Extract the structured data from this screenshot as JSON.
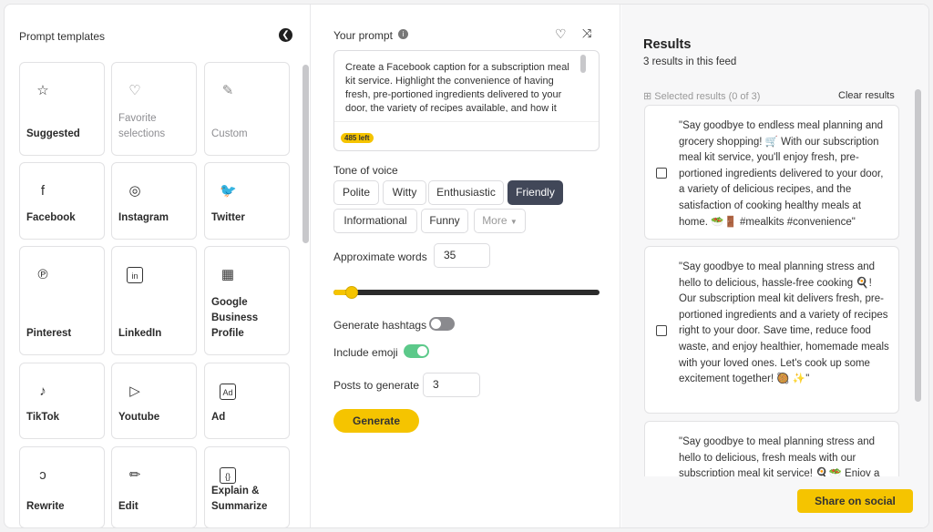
{
  "templates": {
    "title": "Prompt templates",
    "items": [
      {
        "label": "Suggested",
        "icon": "star-icon",
        "glyph": "☆"
      },
      {
        "label": "Favorite selections",
        "icon": "heart-icon",
        "glyph": "♡"
      },
      {
        "label": "Custom",
        "icon": "tools-icon",
        "glyph": "✎"
      },
      {
        "label": "Facebook",
        "icon": "facebook-icon",
        "glyph": "f"
      },
      {
        "label": "Instagram",
        "icon": "instagram-icon",
        "glyph": "◎"
      },
      {
        "label": "Twitter",
        "icon": "twitter-icon",
        "glyph": "🐦"
      },
      {
        "label": "Pinterest",
        "icon": "pinterest-icon",
        "glyph": "℗"
      },
      {
        "label": "LinkedIn",
        "icon": "linkedin-icon",
        "glyph": "in"
      },
      {
        "label": "Google Business Profile",
        "icon": "storefront-icon",
        "glyph": "▦"
      },
      {
        "label": "TikTok",
        "icon": "tiktok-icon",
        "glyph": "♪"
      },
      {
        "label": "Youtube",
        "icon": "youtube-icon",
        "glyph": "▷"
      },
      {
        "label": "Ad",
        "icon": "ad-icon",
        "glyph": "Ad"
      },
      {
        "label": "Rewrite",
        "icon": "rewrite-icon",
        "glyph": "ↄ"
      },
      {
        "label": "Edit",
        "icon": "pencil-icon",
        "glyph": "✏"
      },
      {
        "label": "Explain & Summarize",
        "icon": "brackets-icon",
        "glyph": "{}"
      }
    ]
  },
  "prompt": {
    "title": "Your prompt",
    "text": "Create a Facebook caption for a subscription meal kit service. Highlight the convenience of having fresh, pre-portioned ingredients delivered to your door, the variety of recipes available, and how it",
    "remaining": "485 left",
    "tone_label": "Tone of voice",
    "tones": [
      "Polite",
      "Witty",
      "Enthusiastic",
      "Friendly",
      "Informational",
      "Funny",
      "More"
    ],
    "selected_tone": "Friendly",
    "words_label": "Approximate words",
    "words_value": "35",
    "slider_fraction": 0.05,
    "hashtags_label": "Generate hashtags",
    "hashtags_on": false,
    "emoji_label": "Include emoji",
    "emoji_on": true,
    "posts_label": "Posts to generate",
    "posts_value": "3",
    "generate": "Generate"
  },
  "results": {
    "title": "Results",
    "subtitle": "3 results in this feed",
    "selected": "Selected results (0 of 3)",
    "clear": "Clear results",
    "items": [
      "\"Say goodbye to endless meal planning and grocery shopping! 🛒 With our subscription meal kit service, you'll enjoy fresh, pre-portioned ingredients delivered to your door, a variety of delicious recipes, and the satisfaction of cooking healthy meals at home. 🥗🚪 #mealkits #convenience\"",
      "\"Say goodbye to meal planning stress and hello to delicious, hassle-free cooking 🍳! Our subscription meal kit delivers fresh, pre-portioned ingredients and a variety of recipes right to your door. Save time, reduce food waste, and enjoy healthier, homemade meals with your loved ones. Let's cook up some excitement together! 🥘 ✨\"",
      "\"Say goodbye to meal planning stress and hello to delicious, fresh meals with our subscription meal kit service! 🍳🥗 Enjoy a"
    ],
    "share": "Share on social"
  },
  "colors": {
    "accent": "#f5c400",
    "selected_chip": "#414758",
    "toggle_on": "#5cc98a"
  }
}
